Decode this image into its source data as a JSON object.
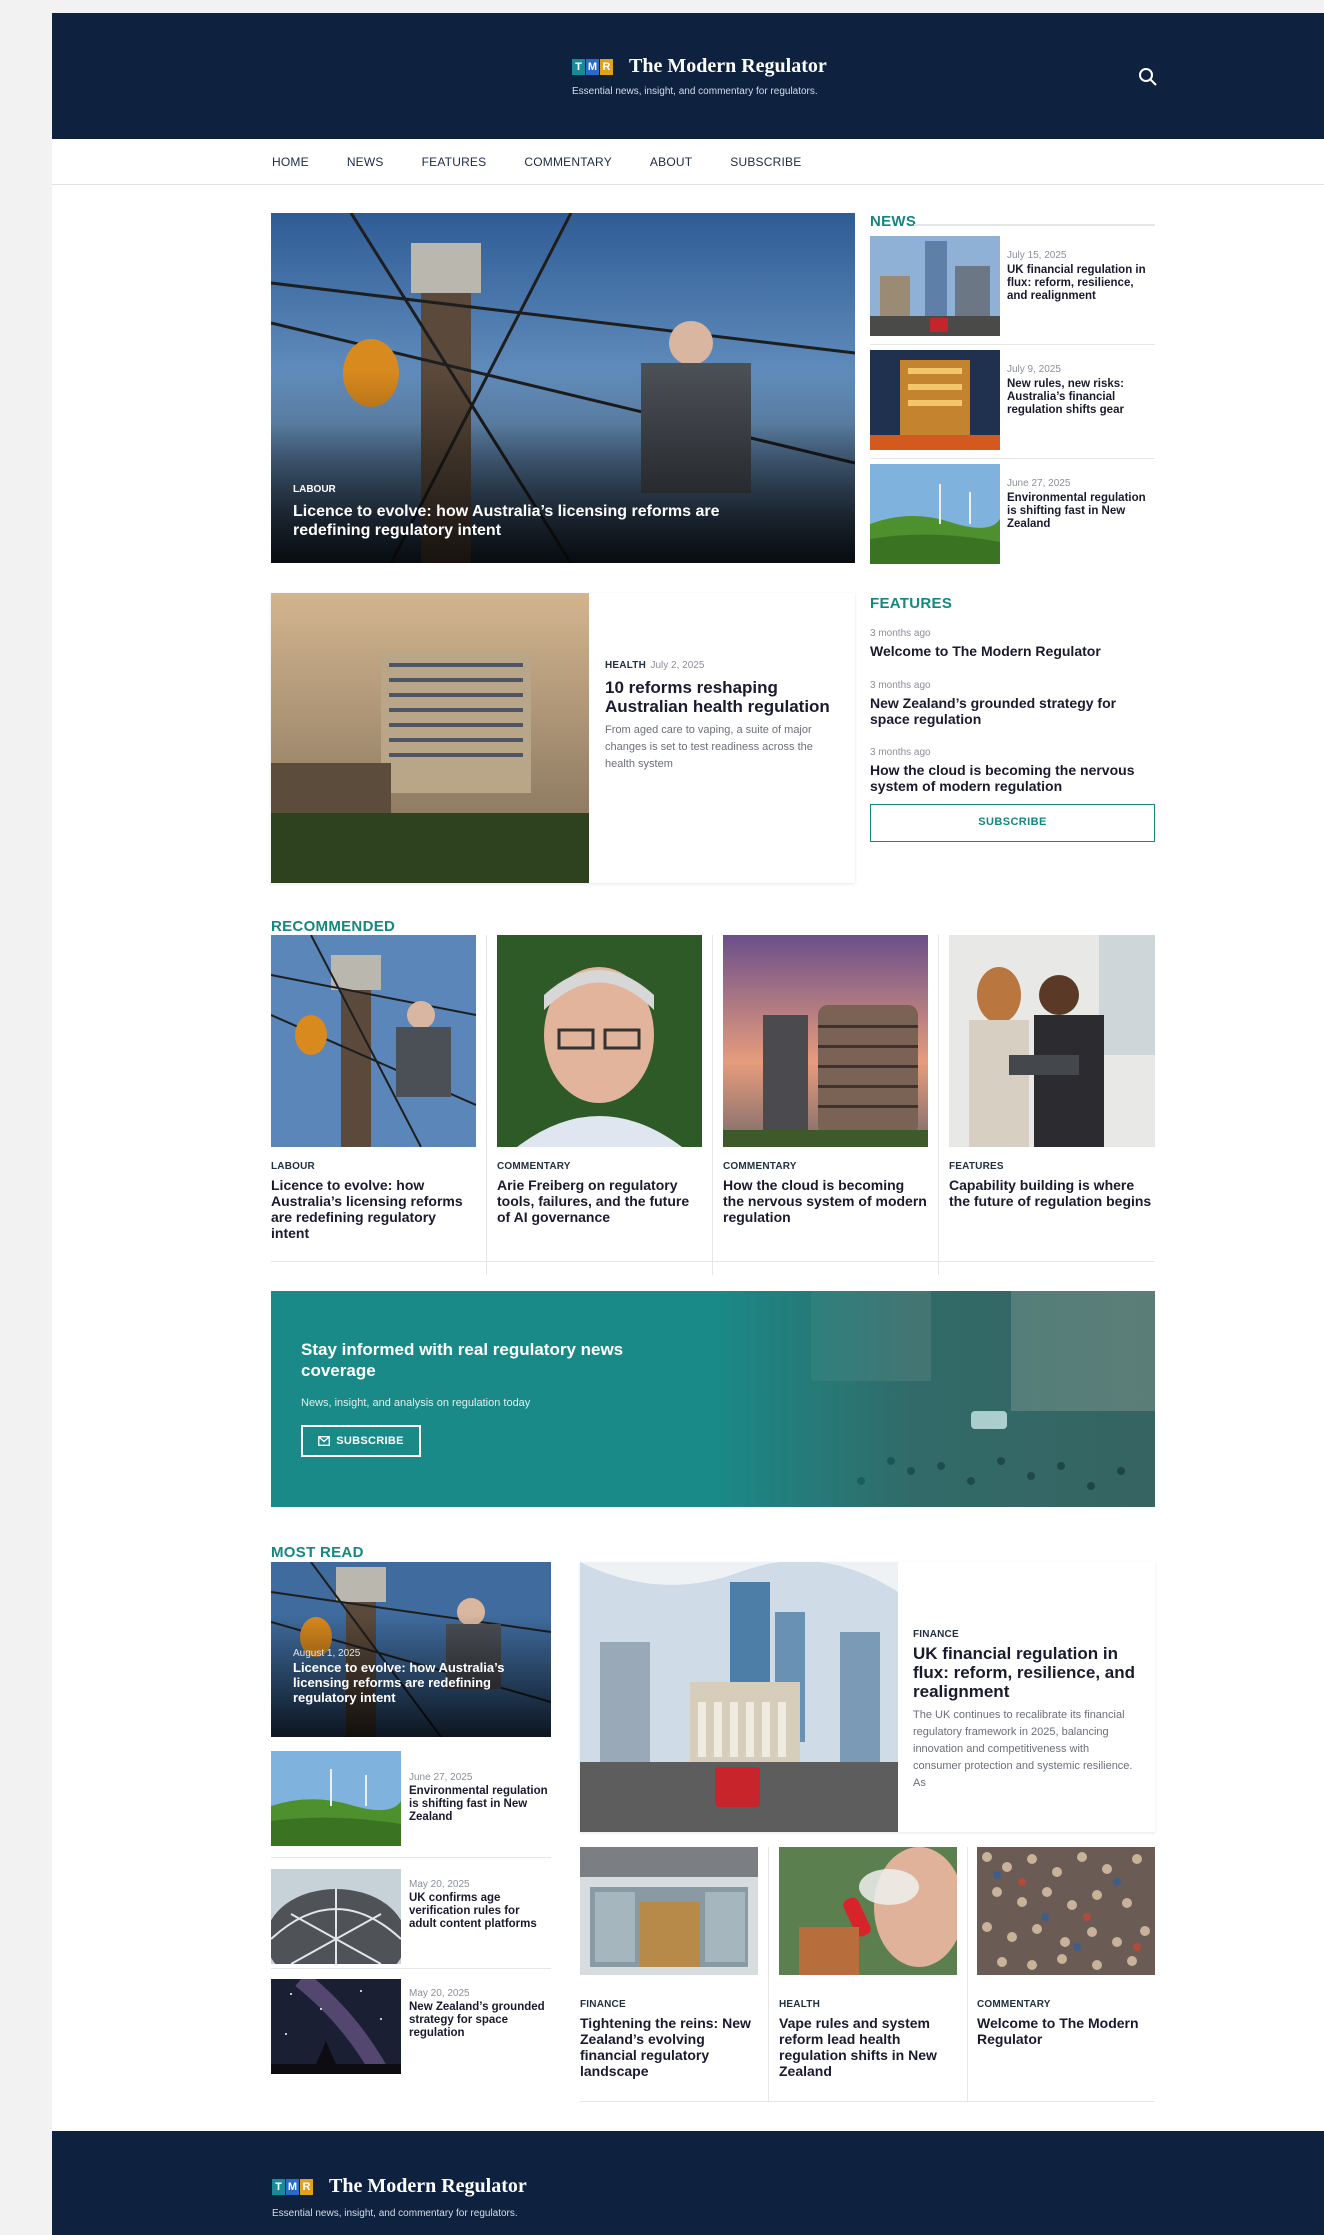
{
  "brand": {
    "name": "The Modern Regulator",
    "tagline": "Essential news, insight, and commentary for regulators.",
    "mark": [
      "T",
      "M",
      "R"
    ]
  },
  "nav": [
    "HOME",
    "NEWS",
    "FEATURES",
    "COMMENTARY",
    "ABOUT",
    "SUBSCRIBE"
  ],
  "hero": {
    "category": "LABOUR",
    "title": "Licence to evolve: how Australia’s licensing reforms are redefining regulatory intent"
  },
  "news": {
    "title": "NEWS",
    "items": [
      {
        "date": "July 15, 2025",
        "title": "UK financial regulation in flux: reform, resilience, and realignment"
      },
      {
        "date": "July 9, 2025",
        "title": "New rules, new risks: Australia’s financial regulation shifts gear"
      },
      {
        "date": "June 27, 2025",
        "title": "Environmental regulation is shifting fast in New Zealand"
      }
    ]
  },
  "health_feature": {
    "category": "HEALTH",
    "date": "July 2, 2025",
    "title": "10 reforms reshaping Australian health regulation",
    "excerpt": "From aged care to vaping, a suite of major changes is set to test readiness across the health system"
  },
  "features": {
    "title": "FEATURES",
    "items": [
      {
        "time": "3 months ago",
        "title": "Welcome to The Modern Regulator"
      },
      {
        "time": "3 months ago",
        "title": "New Zealand’s grounded strategy for space regulation"
      },
      {
        "time": "3 months ago",
        "title": "How the cloud is becoming the nervous system of modern regulation"
      }
    ],
    "subscribe_label": "SUBSCRIBE"
  },
  "recommended": {
    "title": "RECOMMENDED",
    "items": [
      {
        "category": "LABOUR",
        "title": "Licence to evolve: how Australia’s licensing reforms are redefining regulatory intent"
      },
      {
        "category": "COMMENTARY",
        "title": "Arie Freiberg on regulatory tools, failures, and the future of AI governance"
      },
      {
        "category": "COMMENTARY",
        "title": "How the cloud is becoming the nervous system of modern regulation"
      },
      {
        "category": "FEATURES",
        "title": "Capability building is where the future of regulation begins"
      }
    ]
  },
  "banner": {
    "title": "Stay informed with real regulatory news coverage",
    "subtitle": "News, insight, and analysis on regulation today",
    "button": "SUBSCRIBE"
  },
  "most_read": {
    "title": "MOST READ",
    "top": {
      "date": "August 1, 2025",
      "title": "Licence to evolve: how Australia’s licensing reforms are redefining regulatory intent"
    },
    "list": [
      {
        "date": "June 27, 2025",
        "title": "Environmental regulation is shifting fast in New Zealand"
      },
      {
        "date": "May 20, 2025",
        "title": "UK confirms age verification rules for adult content platforms"
      },
      {
        "date": "May 20, 2025",
        "title": "New Zealand’s grounded strategy for space regulation"
      }
    ],
    "featured": {
      "category": "FINANCE",
      "title": "UK financial regulation in flux: reform, resilience, and realignment",
      "excerpt": "The UK continues to recalibrate its financial regulatory framework in 2025, balancing innovation and competitiveness with consumer protection and systemic resilience. As"
    },
    "cards": [
      {
        "category": "FINANCE",
        "title": "Tightening the reins: New Zealand’s evolving financial regulatory landscape"
      },
      {
        "category": "HEALTH",
        "title": "Vape rules and system reform lead health regulation shifts in New Zealand"
      },
      {
        "category": "COMMENTARY",
        "title": "Welcome to The Modern Regulator"
      }
    ]
  },
  "colors": {
    "navy": "#0e2240",
    "teal": "#14877f",
    "banner": "#1a8a88"
  }
}
